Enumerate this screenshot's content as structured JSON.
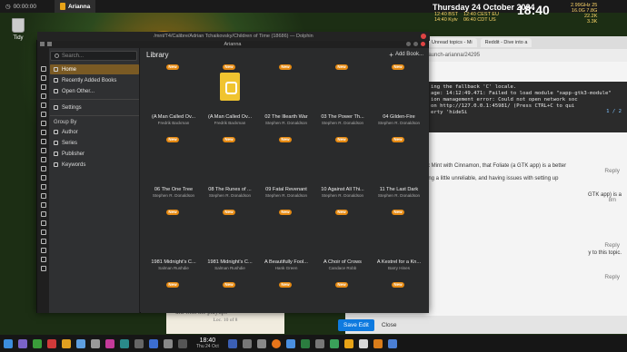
{
  "top_panel": {
    "clock": "00:00:00",
    "task_label": "Arianna"
  },
  "desktop": {
    "date": "Thursday 24 October 2024",
    "timezones": [
      "12:40 BST",
      "12:40 CEST EU",
      "14:40 Kyiv",
      "06:40 CDT US"
    ],
    "big_clock": "18:40",
    "stats": [
      "2.99GHz 25",
      "16.0G 7.8G",
      "22.2K",
      "3.3K"
    ],
    "trash_label": "Tidy"
  },
  "browser": {
    "tabs": [
      "Unread topics - Mi",
      "Reddit - Dive into a"
    ],
    "url": "launch-arianna/24295",
    "terminal_lines": [
      "ing the fallback 'C' locale.",
      "age: 14:12:49.471: Failed to load module \"xapp-gtk3-module\"",
      "ion management error: Could not open network soc",
      "on http://127.0.0.1:45981/ (Press CTRL+C to qui",
      "",
      "                                     erty 'hideSi"
    ],
    "pager": "1 / 2",
    "forum_lines": [
      "x Mint with Cinnamon, that Foliate (a GTK app) is a better",
      "",
      "ing a little unreliable, and having issues with setting up",
      "",
      "GTK app) is a",
      "",
      "y to this topic."
    ],
    "reply_label": "Reply",
    "time_label": "8m",
    "save_label": "Save Edit",
    "close_label": "Close"
  },
  "reader": {
    "text": "did with the playups",
    "loc": "Loc. 10 of 8"
  },
  "dolphin": {
    "title": "/mnt/T4/Calibre/Adrian Tchaikovsky/Children of Time (18686) — Dolphin"
  },
  "arianna": {
    "window_title": "Arianna",
    "search_placeholder": "Search...",
    "nav": [
      {
        "label": "Home",
        "active": true
      },
      {
        "label": "Recently Added Books",
        "active": false
      },
      {
        "label": "Open Other...",
        "active": false
      },
      {
        "label": "Settings",
        "active": false
      }
    ],
    "group_by_label": "Group By",
    "groups": [
      "Author",
      "Series",
      "Publisher",
      "Keywords"
    ],
    "main_title": "Library",
    "add_book_label": "Add Book...",
    "new_badge": "New",
    "books": [
      {
        "title": "(A Man Called Ov...",
        "author": "Fredrik Backman",
        "cover": false
      },
      {
        "title": "(A Man Called Ov...",
        "author": "Fredrik Backman",
        "cover": true
      },
      {
        "title": "02 The Illearth War",
        "author": "Stephen R. Donaldson",
        "cover": false
      },
      {
        "title": "03 The Power Th...",
        "author": "Stephen R. Donaldson",
        "cover": false
      },
      {
        "title": "04 Gilden-Fire",
        "author": "Stephen R. Donaldson",
        "cover": false
      },
      {
        "title": "06 The One Tree",
        "author": "Stephen R. Donaldson",
        "cover": false
      },
      {
        "title": "08 The Runes of ...",
        "author": "Stephen R. Donaldson",
        "cover": false
      },
      {
        "title": "09 Fatal Revenant",
        "author": "Stephen R. Donaldson",
        "cover": false
      },
      {
        "title": "10 Against All Thi...",
        "author": "Stephen R. Donaldson",
        "cover": false
      },
      {
        "title": "11 The Last Dark",
        "author": "Stephen R. Donaldson",
        "cover": false
      },
      {
        "title": "1981 Midnight's C...",
        "author": "Salman Rushdie",
        "cover": false
      },
      {
        "title": "1981 Midnight's C...",
        "author": "Salman Rushdie",
        "cover": false
      },
      {
        "title": "A Beautifully Fool...",
        "author": "Hank Green",
        "cover": false
      },
      {
        "title": "A Choir of Crows",
        "author": "Candace Robb",
        "cover": false
      },
      {
        "title": "A Kestrel for a Kn...",
        "author": "Barry Hines",
        "cover": false
      },
      {
        "title": "",
        "author": "",
        "cover": false
      },
      {
        "title": "",
        "author": "",
        "cover": false
      },
      {
        "title": "",
        "author": "",
        "cover": false
      },
      {
        "title": "",
        "author": "",
        "cover": false
      },
      {
        "title": "",
        "author": "",
        "cover": false
      }
    ]
  },
  "taskbar": {
    "time": "18:40",
    "date": "Thu 24 Oct"
  },
  "colors": {
    "accent": "#e68a12",
    "sidebar_active": "#7a5a24",
    "cover": "#f0c430"
  }
}
